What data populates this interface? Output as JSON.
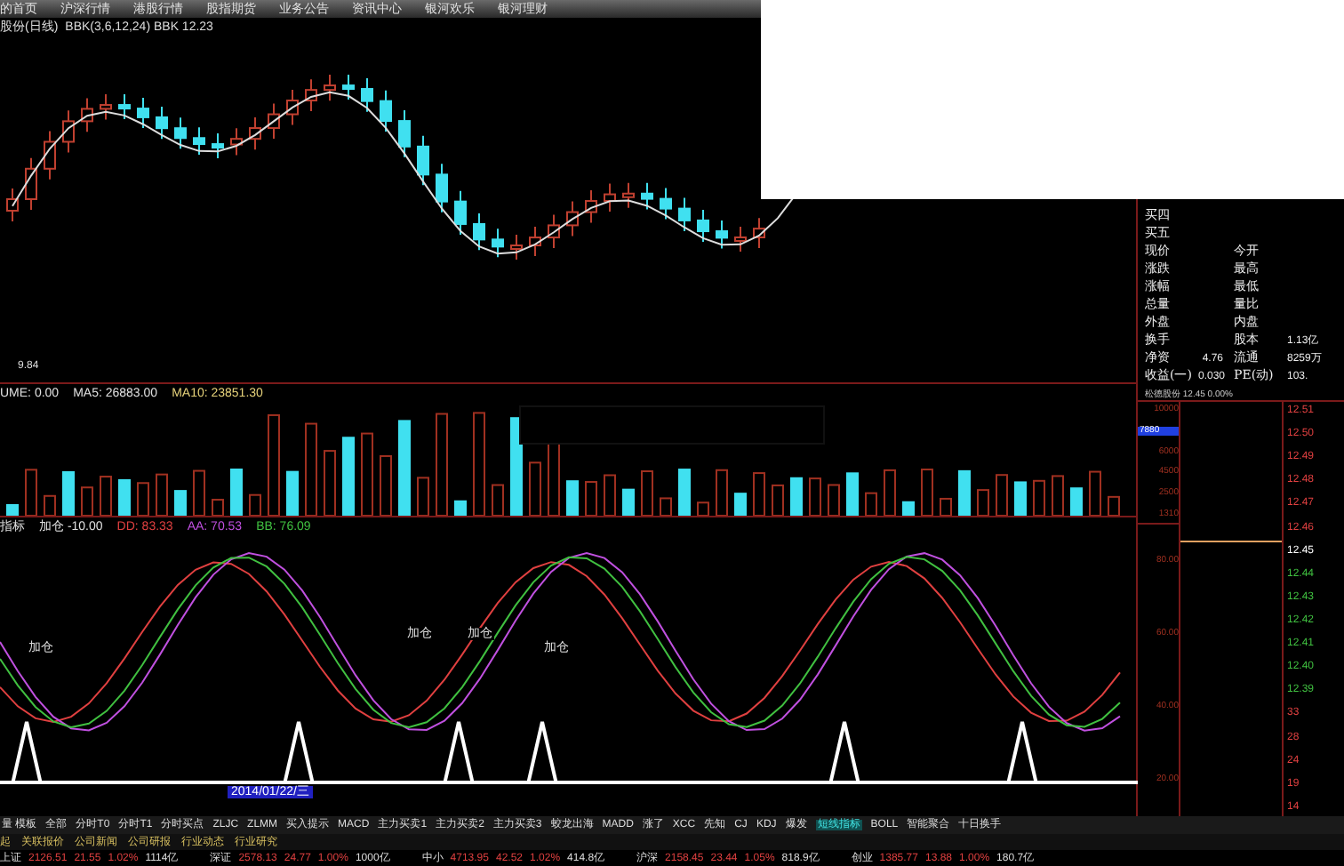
{
  "menu": [
    "的首页",
    "沪深行情",
    "港股行情",
    "股指期货",
    "业务公告",
    "资讯中心",
    "银河欢乐",
    "银河理财"
  ],
  "chart_title": {
    "name": "股份(日线)",
    "indicator": "BBK(3,6,12,24) BBK 12.23"
  },
  "low_label": "9.84",
  "quote_panel": {
    "rows": [
      {
        "left": "买四",
        "mid": "",
        "right": "",
        "value": ""
      },
      {
        "left": "买五",
        "mid": "",
        "right": "",
        "value": ""
      },
      {
        "left": "现价",
        "mid": "",
        "right": "今开",
        "value": ""
      },
      {
        "left": "涨跌",
        "mid": "",
        "right": "最高",
        "value": ""
      },
      {
        "left": "涨幅",
        "mid": "",
        "right": "最低",
        "value": ""
      },
      {
        "left": "总量",
        "mid": "",
        "right": "量比",
        "value": ""
      },
      {
        "left": "外盘",
        "mid": "",
        "right": "内盘",
        "value": ""
      },
      {
        "left": "换手",
        "mid": "",
        "right": "股本",
        "value": "1.13亿"
      },
      {
        "left": "净资",
        "mid": "4.76",
        "right": "流通",
        "value": "8259万"
      },
      {
        "left": "收益(一)",
        "mid": "0.030",
        "right": "PE(动)",
        "value": "103."
      }
    ],
    "footer": "松德股份 12.45 0.00%"
  },
  "volume_header": [
    {
      "text": "UME: 0.00",
      "color": "#e0e0e0"
    },
    {
      "text": "MA5: 26883.00",
      "color": "#e0e0e0"
    },
    {
      "text": "MA10: 23851.30",
      "color": "#e6d27a"
    }
  ],
  "volume_scale": [
    {
      "text": "10000",
      "selected": false
    },
    {
      "text": "7880",
      "selected": true
    },
    {
      "text": "6000",
      "selected": false
    },
    {
      "text": "4500",
      "selected": false
    },
    {
      "text": "2500",
      "selected": false
    },
    {
      "text": "1310",
      "selected": false
    }
  ],
  "indicator_header": [
    {
      "text": "指标",
      "color": "#e0e0e0"
    },
    {
      "text": "加仓 -10.00",
      "color": "#e0e0e0"
    },
    {
      "text": "DD: 83.33",
      "color": "#e04040"
    },
    {
      "text": "AA: 70.53",
      "color": "#c050e0"
    },
    {
      "text": "BB: 76.09",
      "color": "#40c040"
    }
  ],
  "indicator_scale": [
    "80.00",
    "60.00",
    "40.00",
    "20.00"
  ],
  "add_labels": [
    "加仓",
    "加仓",
    "加仓",
    "加仓"
  ],
  "price_scale": [
    {
      "text": "12.51",
      "color": "#e04040"
    },
    {
      "text": "12.50",
      "color": "#e04040"
    },
    {
      "text": "12.49",
      "color": "#e04040"
    },
    {
      "text": "12.48",
      "color": "#e04040"
    },
    {
      "text": "12.47",
      "color": "#e04040"
    },
    {
      "text": "12.46",
      "color": "#e04040"
    },
    {
      "text": "12.45",
      "color": "#ffffff"
    },
    {
      "text": "12.44",
      "color": "#40c040"
    },
    {
      "text": "12.43",
      "color": "#40c040"
    },
    {
      "text": "12.42",
      "color": "#40c040"
    },
    {
      "text": "12.41",
      "color": "#40c040"
    },
    {
      "text": "12.40",
      "color": "#40c040"
    },
    {
      "text": "12.39",
      "color": "#40c040"
    },
    {
      "text": "33",
      "color": "#e04040"
    },
    {
      "text": "28",
      "color": "#e04040"
    },
    {
      "text": "24",
      "color": "#e04040"
    },
    {
      "text": "19",
      "color": "#e04040"
    },
    {
      "text": "14",
      "color": "#e04040"
    }
  ],
  "date_axis": {
    "date": "2014/01/22/三"
  },
  "tabs": [
    {
      "label": "量 模板",
      "selected": false
    },
    {
      "label": "全部",
      "selected": false
    },
    {
      "label": "分时T0",
      "selected": false
    },
    {
      "label": "分时T1",
      "selected": false
    },
    {
      "label": "分时买点",
      "selected": false
    },
    {
      "label": "ZLJC",
      "selected": false
    },
    {
      "label": "ZLMM",
      "selected": false
    },
    {
      "label": "买入提示",
      "selected": false
    },
    {
      "label": "MACD",
      "selected": false
    },
    {
      "label": "主力买卖1",
      "selected": false
    },
    {
      "label": "主力买卖2",
      "selected": false
    },
    {
      "label": "主力买卖3",
      "selected": false
    },
    {
      "label": "蛟龙出海",
      "selected": false
    },
    {
      "label": "MADD",
      "selected": false
    },
    {
      "label": "涨了",
      "selected": false
    },
    {
      "label": "XCC",
      "selected": false
    },
    {
      "label": "先知",
      "selected": false
    },
    {
      "label": "CJ",
      "selected": false
    },
    {
      "label": "KDJ",
      "selected": false
    },
    {
      "label": "爆发",
      "selected": false
    },
    {
      "label": "短线指标",
      "selected": true
    },
    {
      "label": "BOLL",
      "selected": false
    },
    {
      "label": "智能聚合",
      "selected": false
    },
    {
      "label": "十日换手",
      "selected": false
    }
  ],
  "sub_tabs": [
    "起",
    "关联报价",
    "公司新闻",
    "公司研报",
    "行业动态",
    "行业研究"
  ],
  "ticker": [
    {
      "name": "上证",
      "price": "2126.51",
      "change": "21.55",
      "pct": "1.02%",
      "amount": "1114亿"
    },
    {
      "name": "深证",
      "price": "2578.13",
      "change": "24.77",
      "pct": "1.00%",
      "amount": "1000亿"
    },
    {
      "name": "中小",
      "price": "4713.95",
      "change": "42.52",
      "pct": "1.02%",
      "amount": "414.8亿"
    },
    {
      "name": "沪深",
      "price": "2158.45",
      "change": "23.44",
      "pct": "1.05%",
      "amount": "818.9亿"
    },
    {
      "name": "创业",
      "price": "1385.77",
      "change": "13.88",
      "pct": "1.00%",
      "amount": "180.7亿"
    }
  ]
}
